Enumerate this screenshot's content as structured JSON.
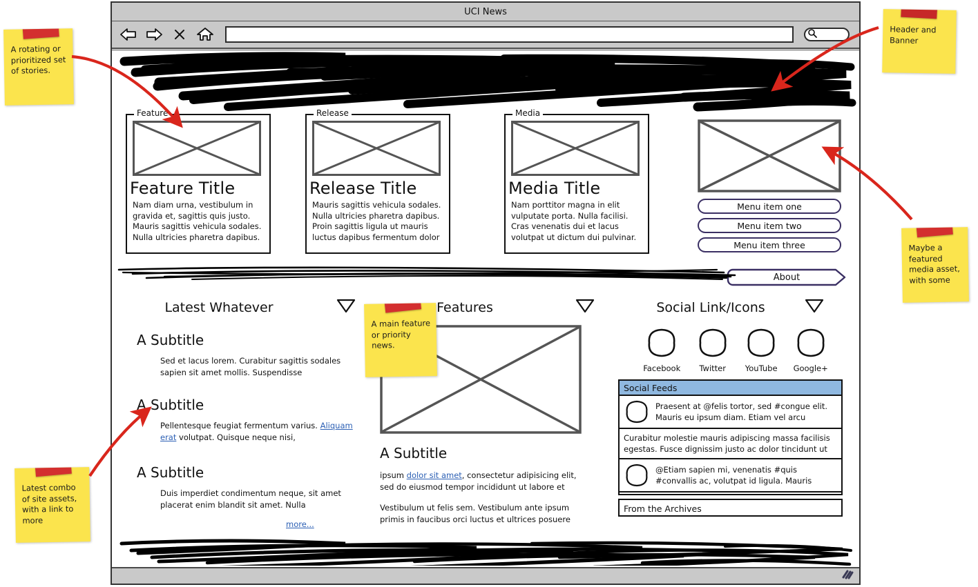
{
  "browser": {
    "window_title": "UCI News",
    "address_value": "",
    "address_placeholder": "",
    "search_value": "",
    "search_placeholder": "",
    "toolbar_icons": [
      "back-arrow-icon",
      "forward-arrow-icon",
      "stop-x-icon",
      "home-icon",
      "search-icon"
    ],
    "status_grip": "resize-grip-icon"
  },
  "banner": {
    "label": "header-banner-scribble"
  },
  "cards": [
    {
      "legend": "Feature",
      "title": "Feature Title",
      "body": "Nam diam urna, vestibulum in gravida et, sagittis quis justo. Mauris sagittis vehicula sodales. Nulla ultricies pharetra dapibus."
    },
    {
      "legend": "Release",
      "title": "Release Title",
      "body": "Mauris sagittis vehicula sodales. Nulla ultricies pharetra dapibus. Proin sagittis ligula ut mauris luctus dapibus fermentum dolor"
    },
    {
      "legend": "Media",
      "title": "Media Title",
      "body": "Nam porttitor magna in elit vulputate porta. Nulla facilisi. Cras venenatis dui et lacus volutpat ut dictum dui pulvinar."
    }
  ],
  "sidebar": {
    "menu_items": [
      "Menu item one",
      "Menu item two",
      "Menu item three"
    ],
    "about_label": "About"
  },
  "columns": {
    "latest": {
      "heading": "Latest Whatever",
      "caret": "chevron-down-icon",
      "items": [
        {
          "subtitle": "A Subtitle",
          "body": "Sed et lacus lorem. Curabitur sagittis sodales sapien sit amet mollis. Suspendisse"
        },
        {
          "subtitle": "A Subtitle",
          "body_pre": "Pellentesque feugiat fermentum varius. ",
          "link": "Aliquam erat",
          "body_post": " volutpat. Quisque neque nisi,"
        },
        {
          "subtitle": "A Subtitle",
          "body": "Duis imperdiet condimentum neque, sit amet placerat enim blandit sit amet. Nulla"
        }
      ],
      "more_link": "more..."
    },
    "features": {
      "heading": "Features",
      "caret": "chevron-down-icon",
      "subtitle": "A Subtitle",
      "para1_pre": " ipsum ",
      "para1_link": "dolor sit amet",
      "para1_post": ", consectetur adipisicing elit, sed do eiusmod tempor incididunt ut labore et",
      "para2": "Vestibulum ut felis sem. Vestibulum ante ipsum primis in faucibus orci luctus et ultrices posuere"
    },
    "social": {
      "heading": "Social Link/Icons",
      "caret": "chevron-down-icon",
      "icons": [
        {
          "label": "Facebook",
          "name": "facebook-icon"
        },
        {
          "label": "Twitter",
          "name": "twitter-icon"
        },
        {
          "label": "YouTube",
          "name": "youtube-icon"
        },
        {
          "label": "Google+",
          "name": "googleplus-icon"
        }
      ],
      "feeds_header": "Social Feeds",
      "feeds": [
        {
          "avatar": true,
          "text": "Praesent at @felis tortor, sed #congue elit. Mauris eu ipsum diam. Etiam vel arcu"
        },
        {
          "avatar": false,
          "text": "Curabitur molestie mauris adipiscing massa facilisis egestas. Fusce dignissim justo ac dolor tincidunt ut"
        },
        {
          "avatar": true,
          "text": "@Etiam sapien mi, venenatis #quis #convallis ac, volutpat id ligula. Mauris"
        }
      ],
      "archives_label": "From the Archives"
    }
  },
  "sticky_notes": [
    {
      "id": "note-rotating-stories",
      "text": "A rotating or prioritized set of stories."
    },
    {
      "id": "note-header-banner",
      "text": "Header and Banner"
    },
    {
      "id": "note-featured-media",
      "text": "Maybe a featured media asset, with some"
    },
    {
      "id": "note-main-feature",
      "text": "A main feature or priority news."
    },
    {
      "id": "note-latest-combo",
      "text": "Latest combo of site assets, with a link to more"
    }
  ],
  "colors": {
    "sticky_yellow": "#fbe44d",
    "tape_red": "#d32f2f",
    "arrow_red": "#d9261c",
    "feeds_header_blue": "#8fb8e0",
    "link_blue": "#2b5fb4",
    "chrome_gray": "#c9c9c9",
    "menu_border": "#3a2f63"
  }
}
